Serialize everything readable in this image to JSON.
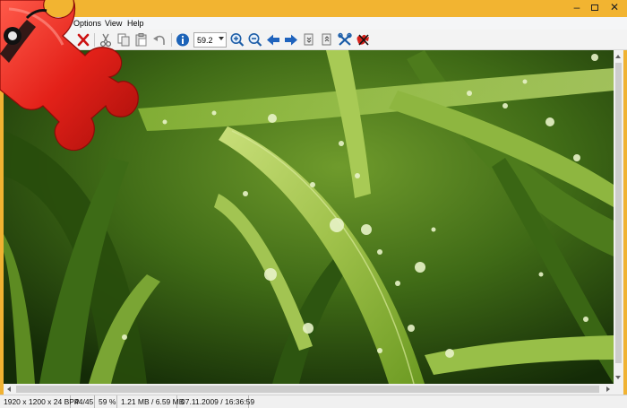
{
  "app": {
    "title": ""
  },
  "menu": {
    "items": [
      {
        "label": "Options"
      },
      {
        "label": "View"
      },
      {
        "label": "Help"
      }
    ]
  },
  "toolbar": {
    "zoom_value": "59.2",
    "icons": [
      "close-icon",
      "cut-icon",
      "copy-icon",
      "paste-icon",
      "undo-icon",
      "info-icon",
      "zoom-in-icon",
      "zoom-out-icon",
      "arrow-left-icon",
      "arrow-right-icon",
      "page-first-icon",
      "page-last-icon",
      "settings-icon",
      "exit-icon"
    ]
  },
  "status": {
    "dimensions": "1920 x 1200 x 24 BPP",
    "index": "44/45",
    "zoom": "59 %",
    "size": "1.21 MB / 6.59 MB",
    "datetime": "07.11.2009 / 16:36:59"
  },
  "colors": {
    "frame": "#f0b232",
    "logo_red": "#e32119",
    "info_blue": "#1c63b8",
    "close_red": "#cc1111"
  }
}
